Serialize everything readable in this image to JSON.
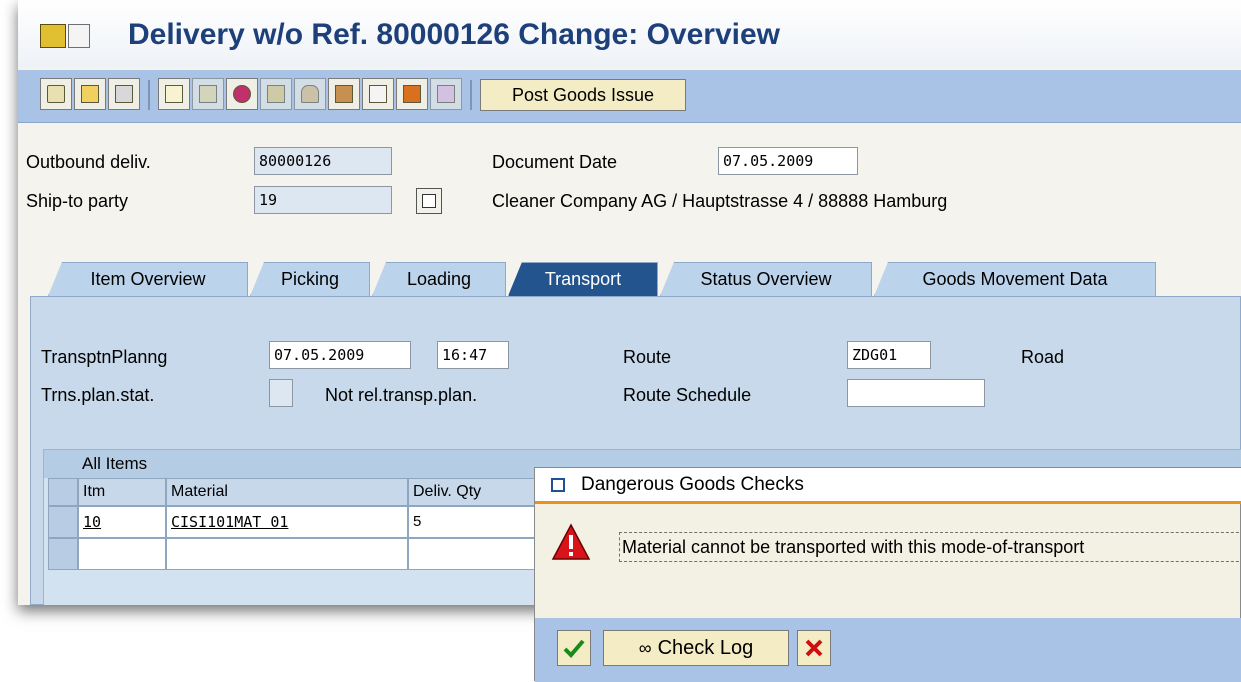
{
  "window": {
    "title": "Delivery w/o Ref. 80000126 Change: Overview"
  },
  "toolbar": {
    "icons": [
      "edit-icon",
      "copy-icon",
      "delete-icon",
      "structure-icon",
      "partner-icon",
      "hat-icon",
      "texts-icon",
      "bell-icon",
      "package-icon",
      "calendar-icon",
      "house-icon",
      "matrix-icon"
    ],
    "post_goods_issue_label": "Post Goods Issue"
  },
  "header": {
    "outbound_deliv_label": "Outbound deliv.",
    "outbound_deliv_value": "80000126",
    "ship_to_label": "Ship-to party",
    "ship_to_value": "19",
    "document_date_label": "Document Date",
    "document_date_value": "07.05.2009",
    "ship_to_address": "Cleaner Company AG / Hauptstrasse 4 / 88888 Hamburg"
  },
  "tabs": [
    {
      "label": "Item Overview",
      "active": false
    },
    {
      "label": "Picking",
      "active": false
    },
    {
      "label": "Loading",
      "active": false
    },
    {
      "label": "Transport",
      "active": true
    },
    {
      "label": "Status Overview",
      "active": false
    },
    {
      "label": "Goods Movement Data",
      "active": false
    }
  ],
  "transport": {
    "planning_label": "TransptnPlanng",
    "planning_date": "07.05.2009",
    "planning_time": "16:47",
    "plan_status_label": "Trns.plan.stat.",
    "plan_status_value": "",
    "plan_status_text": "Not rel.transp.plan.",
    "route_label": "Route",
    "route_value": "ZDG01",
    "route_text": "Road",
    "route_schedule_label": "Route Schedule",
    "route_schedule_value": ""
  },
  "items": {
    "title": "All Items",
    "columns": [
      "Itm",
      "Material",
      "Deliv. Qty"
    ],
    "rows": [
      {
        "itm": "10",
        "material": "CISI101MAT 01",
        "qty": "5"
      }
    ]
  },
  "dialog": {
    "title": "Dangerous Goods Checks",
    "message": "Material cannot be transported with this mode-of-transport",
    "check_log_label": "Check Log",
    "icons": [
      "warning-icon",
      "confirm-check-icon",
      "glasses-icon",
      "cancel-x-icon"
    ]
  },
  "colors": {
    "toolbar_bg": "#a9c3e6",
    "active_tab_bg": "#23548d",
    "tab_bg": "#bcd3ec",
    "dialog_title_accent": "#e8921e",
    "title_text": "#1d3f7a"
  }
}
